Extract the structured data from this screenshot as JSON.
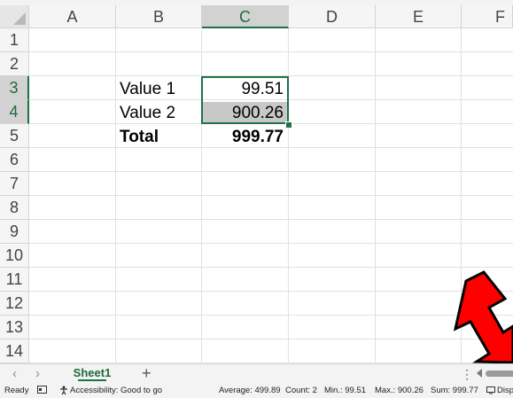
{
  "columns": [
    "A",
    "B",
    "C",
    "D",
    "E",
    "F"
  ],
  "rows": [
    "1",
    "2",
    "3",
    "4",
    "5",
    "6",
    "7",
    "8",
    "9",
    "10",
    "11",
    "12",
    "13",
    "14"
  ],
  "cells": {
    "B3": "Value 1",
    "C3": "99.51",
    "B4": "Value 2",
    "C4": "900.26",
    "B5": "Total",
    "C5": "999.77"
  },
  "sheet_tabs": {
    "nav_prev": "‹",
    "nav_next": "›",
    "active": "Sheet1",
    "add": "+",
    "more": "⋮"
  },
  "status": {
    "ready": "Ready",
    "accessibility": "Accessibility: Good to go",
    "average": "Average:  499.89",
    "count": "Count: 2",
    "min": "Min.:  99.51",
    "max": "Max.:  900.26",
    "sum": "Sum:  999.77",
    "display": "Disp"
  },
  "colors": {
    "accent": "#1f7246",
    "selected_header_bg": "#d2d2d2",
    "annotation_arrow": "#ff0000"
  },
  "icons": [
    "select-all-corner-icon",
    "macro-record-icon",
    "accessibility-icon",
    "display-settings-icon",
    "red-annotation-arrow-icon"
  ]
}
